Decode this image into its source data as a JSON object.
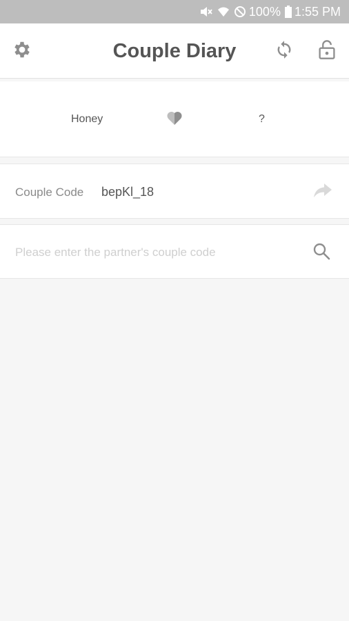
{
  "status_bar": {
    "battery": "100%",
    "time": "1:55 PM",
    "icons": [
      "mute-icon",
      "wifi-icon",
      "do-not-disturb-icon",
      "battery-icon"
    ]
  },
  "app_bar": {
    "title": "Couple Diary",
    "icons": [
      "settings-gear-icon",
      "sync-icon",
      "unlock-icon"
    ]
  },
  "couple": {
    "me_name": "Honey",
    "partner_name": "?",
    "heart_icon": "half-heart-icon"
  },
  "couple_code": {
    "label": "Couple Code",
    "value": "bepKl_18",
    "share_icon": "share-arrow-icon"
  },
  "partner_search": {
    "placeholder": "Please enter the partner's couple code",
    "value": "",
    "search_icon": "search-icon"
  },
  "colors": {
    "status_bar_bg": "#bdbdbd",
    "title_text": "#555555",
    "icon_gray": "#8e8e8e",
    "placeholder": "#cfcfcf",
    "background": "#f6f6f6"
  }
}
